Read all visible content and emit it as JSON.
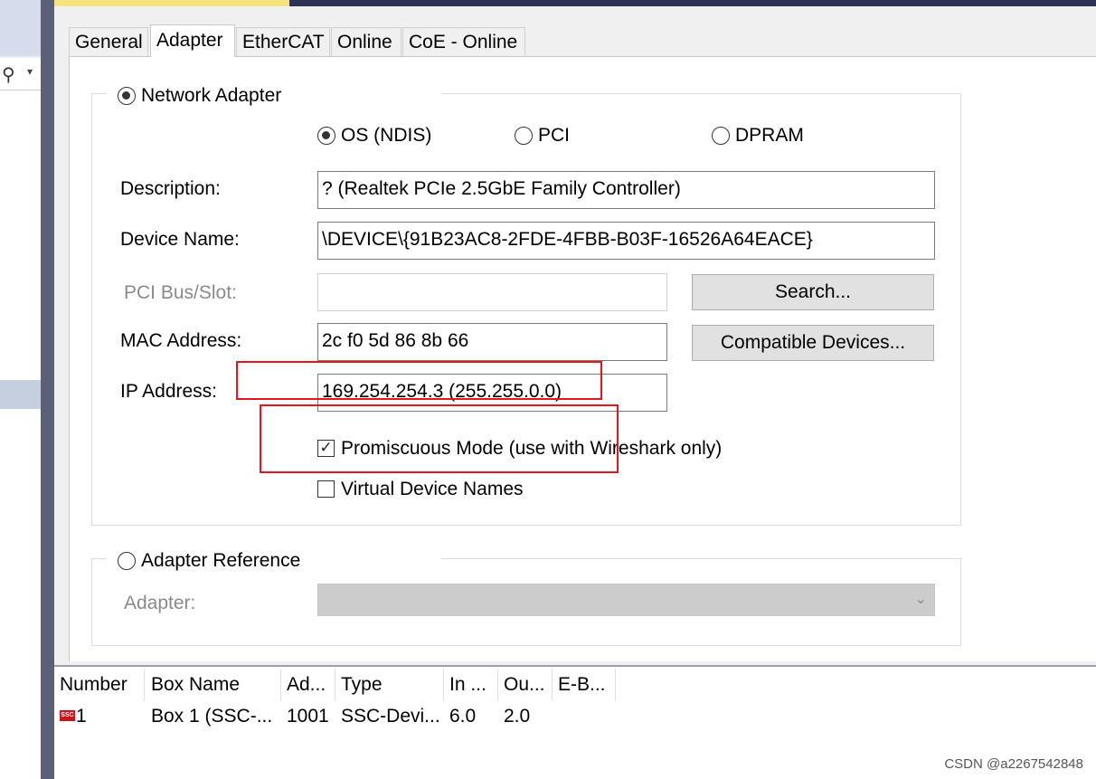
{
  "tabs": [
    {
      "label": "General"
    },
    {
      "label": "Adapter"
    },
    {
      "label": "EtherCAT"
    },
    {
      "label": "Online"
    },
    {
      "label": "CoE - Online"
    }
  ],
  "network_adapter": {
    "label": "Network Adapter",
    "selected": true,
    "mode_options": [
      {
        "label": "OS (NDIS)",
        "selected": true
      },
      {
        "label": "PCI",
        "selected": false
      },
      {
        "label": "DPRAM",
        "selected": false
      }
    ],
    "description_label": "Description:",
    "description_value": "? (Realtek PCIe 2.5GbE Family Controller)",
    "device_name_label": "Device Name:",
    "device_name_value": "\\DEVICE\\{91B23AC8-2FDE-4FBB-B03F-16526A64EACE}",
    "pci_label": "PCI Bus/Slot:",
    "pci_value": "",
    "search_button": "Search...",
    "mac_label": "MAC Address:",
    "mac_value": "2c f0 5d 86 8b 66",
    "compatible_button": "Compatible Devices...",
    "ip_label": "IP Address:",
    "ip_value": "169.254.254.3 (255.255.0.0)",
    "promiscuous_label": "Promiscuous Mode (use with Wireshark only)",
    "promiscuous_checked": true,
    "virtual_names_label": "Virtual Device Names",
    "virtual_names_checked": false
  },
  "adapter_reference": {
    "label": "Adapter Reference",
    "selected": false,
    "adapter_label": "Adapter:",
    "adapter_value": ""
  },
  "list": {
    "columns": [
      "Number",
      "Box Name",
      "Ad...",
      "Type",
      "In ...",
      "Ou...",
      "E-B..."
    ],
    "rows": [
      {
        "icon": "ssc-device-icon",
        "number": "1",
        "box_name": "Box 1 (SSC-...",
        "address": "1001",
        "type": "SSC-Devi...",
        "in": "6.0",
        "out": "2.0",
        "eb": ""
      }
    ]
  },
  "watermark": "CSDN @a2267542848",
  "colors": {
    "highlight_red": "#e4161c",
    "ssc_icon_red": "#c8161c"
  }
}
